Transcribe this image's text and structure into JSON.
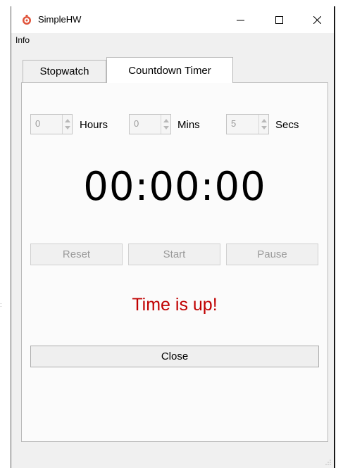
{
  "window": {
    "title": "SimpleHW",
    "icon": "app-icon",
    "controls": {
      "minimize": "minimize-icon",
      "maximize": "maximize-icon",
      "close": "close-icon"
    }
  },
  "menu": {
    "items": [
      {
        "label": "Info"
      }
    ]
  },
  "tabs": [
    {
      "label": "Stopwatch",
      "active": false
    },
    {
      "label": "Countdown Timer",
      "active": true
    }
  ],
  "countdown": {
    "hours": {
      "value": "0",
      "label": "Hours"
    },
    "mins": {
      "value": "0",
      "label": "Mins"
    },
    "secs": {
      "value": "5",
      "label": "Secs"
    },
    "display": "00:00:00",
    "buttons": {
      "reset": "Reset",
      "start": "Start",
      "pause": "Pause"
    },
    "status": "Time is up!",
    "close": "Close"
  },
  "colors": {
    "status": "#c00000",
    "disabled_text": "#9a9a9a"
  }
}
